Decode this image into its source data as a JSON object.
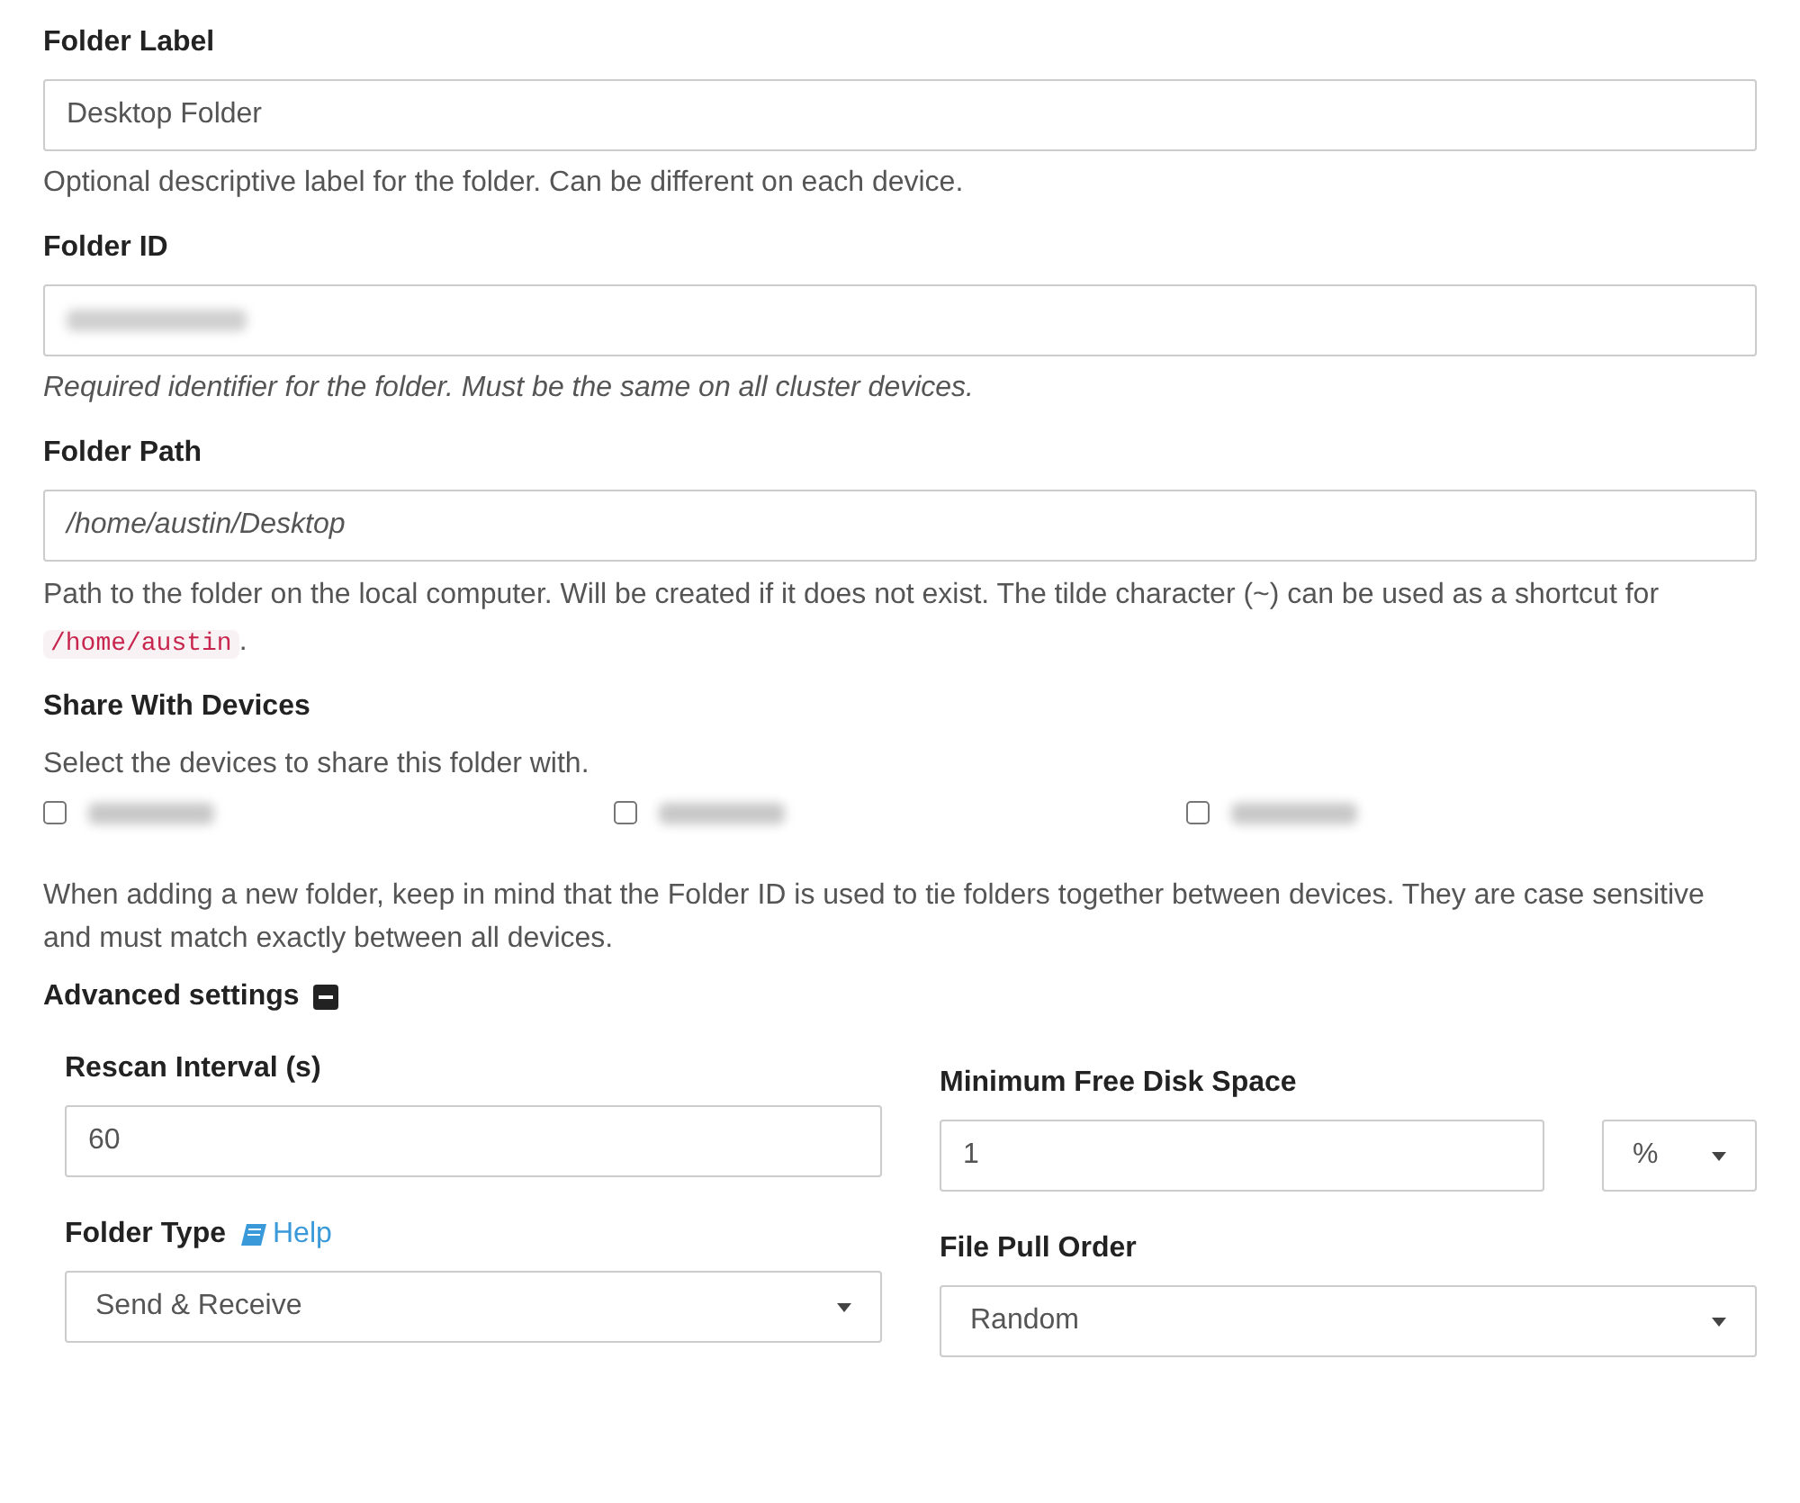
{
  "folder_label": {
    "label": "Folder Label",
    "value": "Desktop Folder",
    "hint": "Optional descriptive label for the folder. Can be different on each device."
  },
  "folder_id": {
    "label": "Folder ID",
    "hint": "Required identifier for the folder. Must be the same on all cluster devices."
  },
  "folder_path": {
    "label": "Folder Path",
    "value": "/home/austin/Desktop",
    "hint_before": "Path to the folder on the local computer. Will be created if it does not exist. The tilde character (~) can be used as a shortcut for",
    "hint_code": "/home/austin",
    "hint_after": "."
  },
  "share": {
    "title": "Share With Devices",
    "hint": "Select the devices to share this folder with.",
    "devices": [
      {
        "checked": false
      },
      {
        "checked": false
      },
      {
        "checked": false
      }
    ],
    "note": "When adding a new folder, keep in mind that the Folder ID is used to tie folders together between devices. They are case sensitive and must match exactly between all devices."
  },
  "advanced": {
    "title": "Advanced settings",
    "expanded": true
  },
  "rescan": {
    "label": "Rescan Interval (s)",
    "value": "60"
  },
  "min_disk": {
    "label": "Minimum Free Disk Space",
    "value": "1",
    "unit": "%"
  },
  "folder_type": {
    "label": "Folder Type",
    "help": "Help",
    "value": "Send & Receive"
  },
  "pull_order": {
    "label": "File Pull Order",
    "value": "Random"
  }
}
